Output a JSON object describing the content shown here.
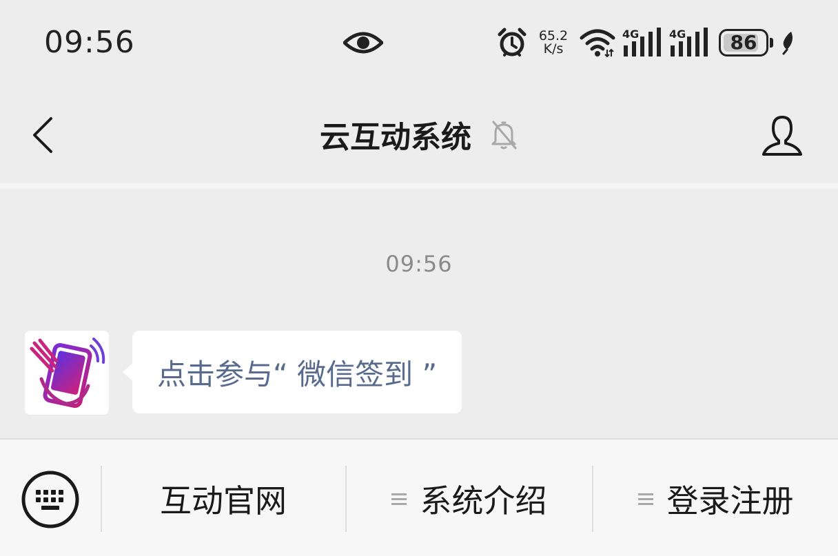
{
  "status_bar": {
    "time": "09:56",
    "speed_value": "65.2",
    "speed_unit": "K/s",
    "signal1_label": "4G",
    "signal2_label": "4G",
    "battery_level": "86"
  },
  "nav": {
    "title": "云互动系统"
  },
  "chat": {
    "timestamp": "09:56",
    "message_link": "点击参与“ 微信签到 ”"
  },
  "menu": {
    "items": [
      {
        "label": "互动官网"
      },
      {
        "label": "系统介绍"
      },
      {
        "label": "登录注册"
      }
    ]
  },
  "colors": {
    "background": "#ededed",
    "bubble": "#ffffff",
    "link": "#586a8e",
    "bottom_bar": "#f7f7f7"
  }
}
